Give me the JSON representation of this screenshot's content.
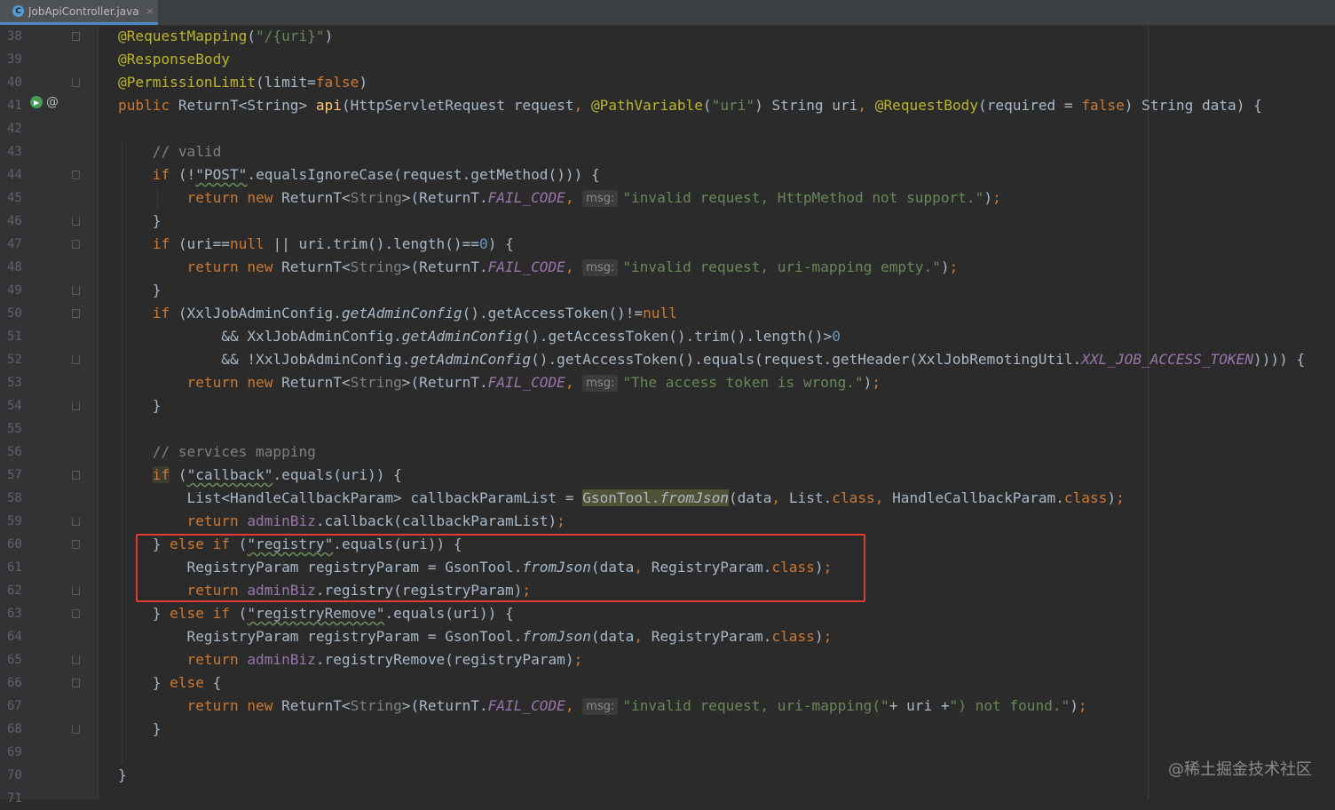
{
  "tab": {
    "filename": "JobApiController.java",
    "icon": "java-class-icon",
    "close": "×"
  },
  "watermark": "@稀土掘金技术社区",
  "colors": {
    "background": "#2b2b2b",
    "keyword": "#cc7832",
    "annotation": "#bbb529",
    "string": "#6a8759",
    "comment": "#808080",
    "number": "#6897bb",
    "method_decl": "#ffc66d",
    "static_field": "#9876aa",
    "highlight_box": "#e53935"
  },
  "highlight": {
    "from_line": 60,
    "to_line": 62
  },
  "lines": [
    {
      "n": "38",
      "seg": [
        [
          "a",
          "@RequestMapping"
        ],
        [
          "",
          "("
        ],
        [
          "s",
          "\"/{uri}\""
        ],
        [
          "",
          ")"
        ]
      ]
    },
    {
      "n": "39",
      "seg": [
        [
          "a",
          "@ResponseBody"
        ]
      ]
    },
    {
      "n": "40",
      "seg": [
        [
          "a",
          "@PermissionLimit"
        ],
        [
          "",
          "(limit="
        ],
        [
          "k",
          "false"
        ],
        [
          "",
          ")"
        ]
      ]
    },
    {
      "n": "41",
      "seg": [
        [
          "k",
          "public "
        ],
        [
          "",
          "ReturnT<String> "
        ],
        [
          "f",
          "api"
        ],
        [
          "",
          "(HttpServletRequest request"
        ],
        [
          "k",
          ", "
        ],
        [
          "a",
          "@PathVariable"
        ],
        [
          "",
          "("
        ],
        [
          "s",
          "\"uri\""
        ],
        [
          "",
          ") String uri"
        ],
        [
          "k",
          ", "
        ],
        [
          "a",
          "@RequestBody"
        ],
        [
          "",
          "(required = "
        ],
        [
          "k",
          "false"
        ],
        [
          "",
          ") String data) {"
        ]
      ]
    },
    {
      "n": "42",
      "seg": []
    },
    {
      "n": "43",
      "seg": [
        [
          "",
          "    "
        ],
        [
          "c",
          "// valid"
        ]
      ]
    },
    {
      "n": "44",
      "seg": [
        [
          "",
          "    "
        ],
        [
          "k",
          "if "
        ],
        [
          "",
          "(!"
        ],
        [
          "sq",
          "\"POST\""
        ],
        [
          "",
          ".equalsIgnoreCase(request.getMethod())) {"
        ]
      ]
    },
    {
      "n": "45",
      "seg": [
        [
          "",
          "        "
        ],
        [
          "k",
          "return new "
        ],
        [
          "",
          "ReturnT<"
        ],
        [
          "t",
          "String"
        ],
        [
          "",
          ">(ReturnT."
        ],
        [
          "st",
          "FAIL_CODE"
        ],
        [
          "k",
          ", "
        ],
        [
          "hint",
          "msg:"
        ],
        [
          "s",
          "\"invalid request, HttpMethod not support.\""
        ],
        [
          "",
          ")"
        ],
        [
          "k",
          ";"
        ]
      ]
    },
    {
      "n": "46",
      "seg": [
        [
          "",
          "    }"
        ]
      ]
    },
    {
      "n": "47",
      "seg": [
        [
          "",
          "    "
        ],
        [
          "k",
          "if "
        ],
        [
          "",
          "(uri=="
        ],
        [
          "k",
          "null "
        ],
        [
          "",
          "|| uri.trim().length()=="
        ],
        [
          "n",
          "0"
        ],
        [
          "",
          ") {"
        ]
      ]
    },
    {
      "n": "48",
      "seg": [
        [
          "",
          "        "
        ],
        [
          "k",
          "return new "
        ],
        [
          "",
          "ReturnT<"
        ],
        [
          "t",
          "String"
        ],
        [
          "",
          ">(ReturnT."
        ],
        [
          "st",
          "FAIL_CODE"
        ],
        [
          "k",
          ", "
        ],
        [
          "hint",
          "msg:"
        ],
        [
          "s",
          "\"invalid request, uri-mapping empty.\""
        ],
        [
          "",
          ")"
        ],
        [
          "k",
          ";"
        ]
      ]
    },
    {
      "n": "49",
      "seg": [
        [
          "",
          "    }"
        ]
      ]
    },
    {
      "n": "50",
      "seg": [
        [
          "",
          "    "
        ],
        [
          "k",
          "if "
        ],
        [
          "",
          "(XxlJobAdminConfig."
        ],
        [
          "i",
          "getAdminConfig"
        ],
        [
          "",
          "().getAccessToken()!="
        ],
        [
          "k",
          "null"
        ]
      ]
    },
    {
      "n": "51",
      "seg": [
        [
          "",
          "            && XxlJobAdminConfig."
        ],
        [
          "i",
          "getAdminConfig"
        ],
        [
          "",
          "().getAccessToken().trim().length()>"
        ],
        [
          "n",
          "0"
        ]
      ]
    },
    {
      "n": "52",
      "seg": [
        [
          "",
          "            && !XxlJobAdminConfig."
        ],
        [
          "i",
          "getAdminConfig"
        ],
        [
          "",
          "().getAccessToken().equals(request.getHeader(XxlJobRemotingUtil."
        ],
        [
          "st",
          "XXL_JOB_ACCESS_TOKEN"
        ],
        [
          "",
          ")))"
        ],
        [
          "",
          ") {"
        ]
      ]
    },
    {
      "n": "53",
      "seg": [
        [
          "",
          "        "
        ],
        [
          "k",
          "return new "
        ],
        [
          "",
          "ReturnT<"
        ],
        [
          "t",
          "String"
        ],
        [
          "",
          ">(ReturnT."
        ],
        [
          "st",
          "FAIL_CODE"
        ],
        [
          "k",
          ", "
        ],
        [
          "hint",
          "msg:"
        ],
        [
          "s",
          "\"The access token is wrong.\""
        ],
        [
          "",
          ")"
        ],
        [
          "k",
          ";"
        ]
      ]
    },
    {
      "n": "54",
      "seg": [
        [
          "",
          "    }"
        ]
      ]
    },
    {
      "n": "55",
      "seg": []
    },
    {
      "n": "56",
      "seg": [
        [
          "",
          "    "
        ],
        [
          "c",
          "// services mapping"
        ]
      ]
    },
    {
      "n": "57",
      "seg": [
        [
          "",
          "    "
        ],
        [
          "k hl-if",
          "if"
        ],
        [
          "k",
          " "
        ],
        [
          "",
          "("
        ],
        [
          "sq",
          "\"callback\""
        ],
        [
          "",
          ".equals(uri)) {"
        ]
      ]
    },
    {
      "n": "58",
      "seg": [
        [
          "",
          "        List<HandleCallbackParam> callbackParamList = "
        ],
        [
          "hl-gson",
          "GsonTool."
        ],
        [
          "hl-gson i",
          "fromJson"
        ],
        [
          "",
          "(data"
        ],
        [
          "k",
          ", "
        ],
        [
          "",
          "List."
        ],
        [
          "k",
          "class"
        ],
        [
          "k",
          ", "
        ],
        [
          "",
          "HandleCallbackParam."
        ],
        [
          "k",
          "class"
        ],
        [
          "",
          ")"
        ],
        [
          "k",
          ";"
        ]
      ]
    },
    {
      "n": "59",
      "seg": [
        [
          "",
          "        "
        ],
        [
          "k",
          "return "
        ],
        [
          "fld",
          "adminBiz"
        ],
        [
          "",
          ".callback(callbackParamList)"
        ],
        [
          "k",
          ";"
        ]
      ]
    },
    {
      "n": "60",
      "seg": [
        [
          "",
          "    } "
        ],
        [
          "k",
          "else if "
        ],
        [
          "",
          "("
        ],
        [
          "sq",
          "\"registry\""
        ],
        [
          "",
          ".equals(uri)) {"
        ]
      ]
    },
    {
      "n": "61",
      "seg": [
        [
          "",
          "        RegistryParam registryParam = GsonTool."
        ],
        [
          "i",
          "fromJson"
        ],
        [
          "",
          "(data"
        ],
        [
          "k",
          ", "
        ],
        [
          "",
          "RegistryParam."
        ],
        [
          "k",
          "class"
        ],
        [
          "",
          ")"
        ],
        [
          "k",
          ";"
        ]
      ]
    },
    {
      "n": "62",
      "seg": [
        [
          "",
          "        "
        ],
        [
          "k",
          "return "
        ],
        [
          "fld",
          "adminBiz"
        ],
        [
          "",
          ".registry(registryParam)"
        ],
        [
          "k",
          ";"
        ]
      ]
    },
    {
      "n": "63",
      "seg": [
        [
          "",
          "    } "
        ],
        [
          "k",
          "else if "
        ],
        [
          "",
          "("
        ],
        [
          "sq",
          "\"registryRemove\""
        ],
        [
          "",
          ".equals(uri)) {"
        ]
      ]
    },
    {
      "n": "64",
      "seg": [
        [
          "",
          "        RegistryParam registryParam = GsonTool."
        ],
        [
          "i",
          "fromJson"
        ],
        [
          "",
          "(data"
        ],
        [
          "k",
          ", "
        ],
        [
          "",
          "RegistryParam."
        ],
        [
          "k",
          "class"
        ],
        [
          "",
          ")"
        ],
        [
          "k",
          ";"
        ]
      ]
    },
    {
      "n": "65",
      "seg": [
        [
          "",
          "        "
        ],
        [
          "k",
          "return "
        ],
        [
          "fld",
          "adminBiz"
        ],
        [
          "",
          ".registryRemove(registryParam)"
        ],
        [
          "k",
          ";"
        ]
      ]
    },
    {
      "n": "66",
      "seg": [
        [
          "",
          "    } "
        ],
        [
          "k",
          "else "
        ],
        [
          "",
          "{"
        ]
      ]
    },
    {
      "n": "67",
      "seg": [
        [
          "",
          "        "
        ],
        [
          "k",
          "return new "
        ],
        [
          "",
          "ReturnT<"
        ],
        [
          "t",
          "String"
        ],
        [
          "",
          ">(ReturnT."
        ],
        [
          "st",
          "FAIL_CODE"
        ],
        [
          "k",
          ", "
        ],
        [
          "hint",
          "msg:"
        ],
        [
          "s",
          "\"invalid request, uri-mapping(\""
        ],
        [
          "",
          "+ uri +"
        ],
        [
          "s",
          "\") not found.\""
        ],
        [
          "",
          ")"
        ],
        [
          "k",
          ";"
        ]
      ]
    },
    {
      "n": "68",
      "seg": [
        [
          "",
          "    }"
        ]
      ]
    },
    {
      "n": "69",
      "seg": []
    },
    {
      "n": "70",
      "seg": [
        [
          "",
          "}"
        ]
      ]
    },
    {
      "n": "71",
      "seg": []
    }
  ]
}
